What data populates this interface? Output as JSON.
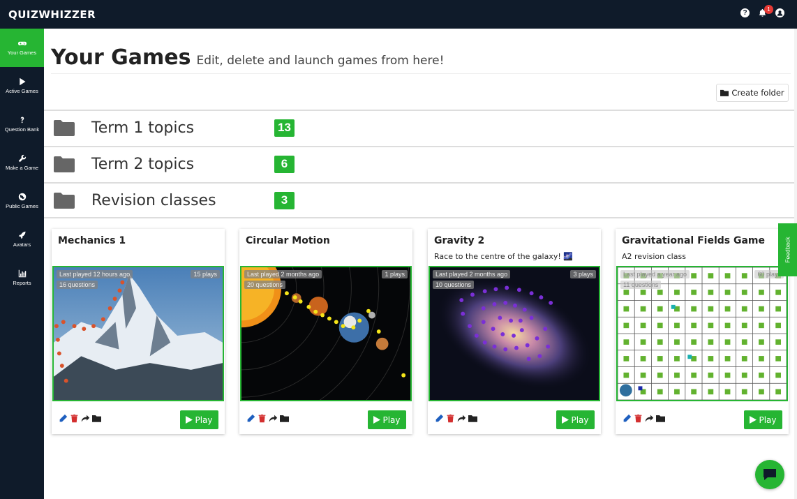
{
  "app": {
    "logo": "QUIZWHIZZER",
    "notification_count": "1"
  },
  "sidebar": {
    "items": [
      {
        "label": "Your Games",
        "icon": "gamepad-icon"
      },
      {
        "label": "Active Games",
        "icon": "play-icon"
      },
      {
        "label": "Question Bank",
        "icon": "question-icon"
      },
      {
        "label": "Make a Game",
        "icon": "wrench-icon"
      },
      {
        "label": "Public Games",
        "icon": "globe-icon"
      },
      {
        "label": "Avatars",
        "icon": "rocket-icon"
      },
      {
        "label": "Reports",
        "icon": "chart-icon"
      }
    ]
  },
  "header": {
    "title": "Your Games",
    "subtitle": "Edit, delete and launch games from here!"
  },
  "create_folder_label": "Create folder",
  "folders": [
    {
      "name": "Term 1 topics",
      "count": "13"
    },
    {
      "name": "Term 2 topics",
      "count": "6"
    },
    {
      "name": "Revision classes",
      "count": "3"
    }
  ],
  "games": [
    {
      "title": "Mechanics 1",
      "description": "",
      "last_played": "Last played 12 hours ago",
      "plays": "15 plays",
      "questions": "16 questions",
      "play_label": "Play"
    },
    {
      "title": "Circular Motion",
      "description": "",
      "last_played": "Last played 2 months ago",
      "plays": "1 plays",
      "questions": "20 questions",
      "play_label": "Play"
    },
    {
      "title": "Gravity 2",
      "description": "Race to the centre of the galaxy! 🌌",
      "last_played": "Last played 2 months ago",
      "plays": "3 plays",
      "questions": "10 questions",
      "play_label": "Play"
    },
    {
      "title": "Gravitational Fields Game",
      "description": "A2 revision class",
      "last_played": "Last played a year ago",
      "plays": "60 plays",
      "questions": "11 questions",
      "play_label": "Play"
    }
  ],
  "feedback_label": "Feedback",
  "colors": {
    "accent": "#26b533",
    "nav": "#0f1b2a"
  }
}
